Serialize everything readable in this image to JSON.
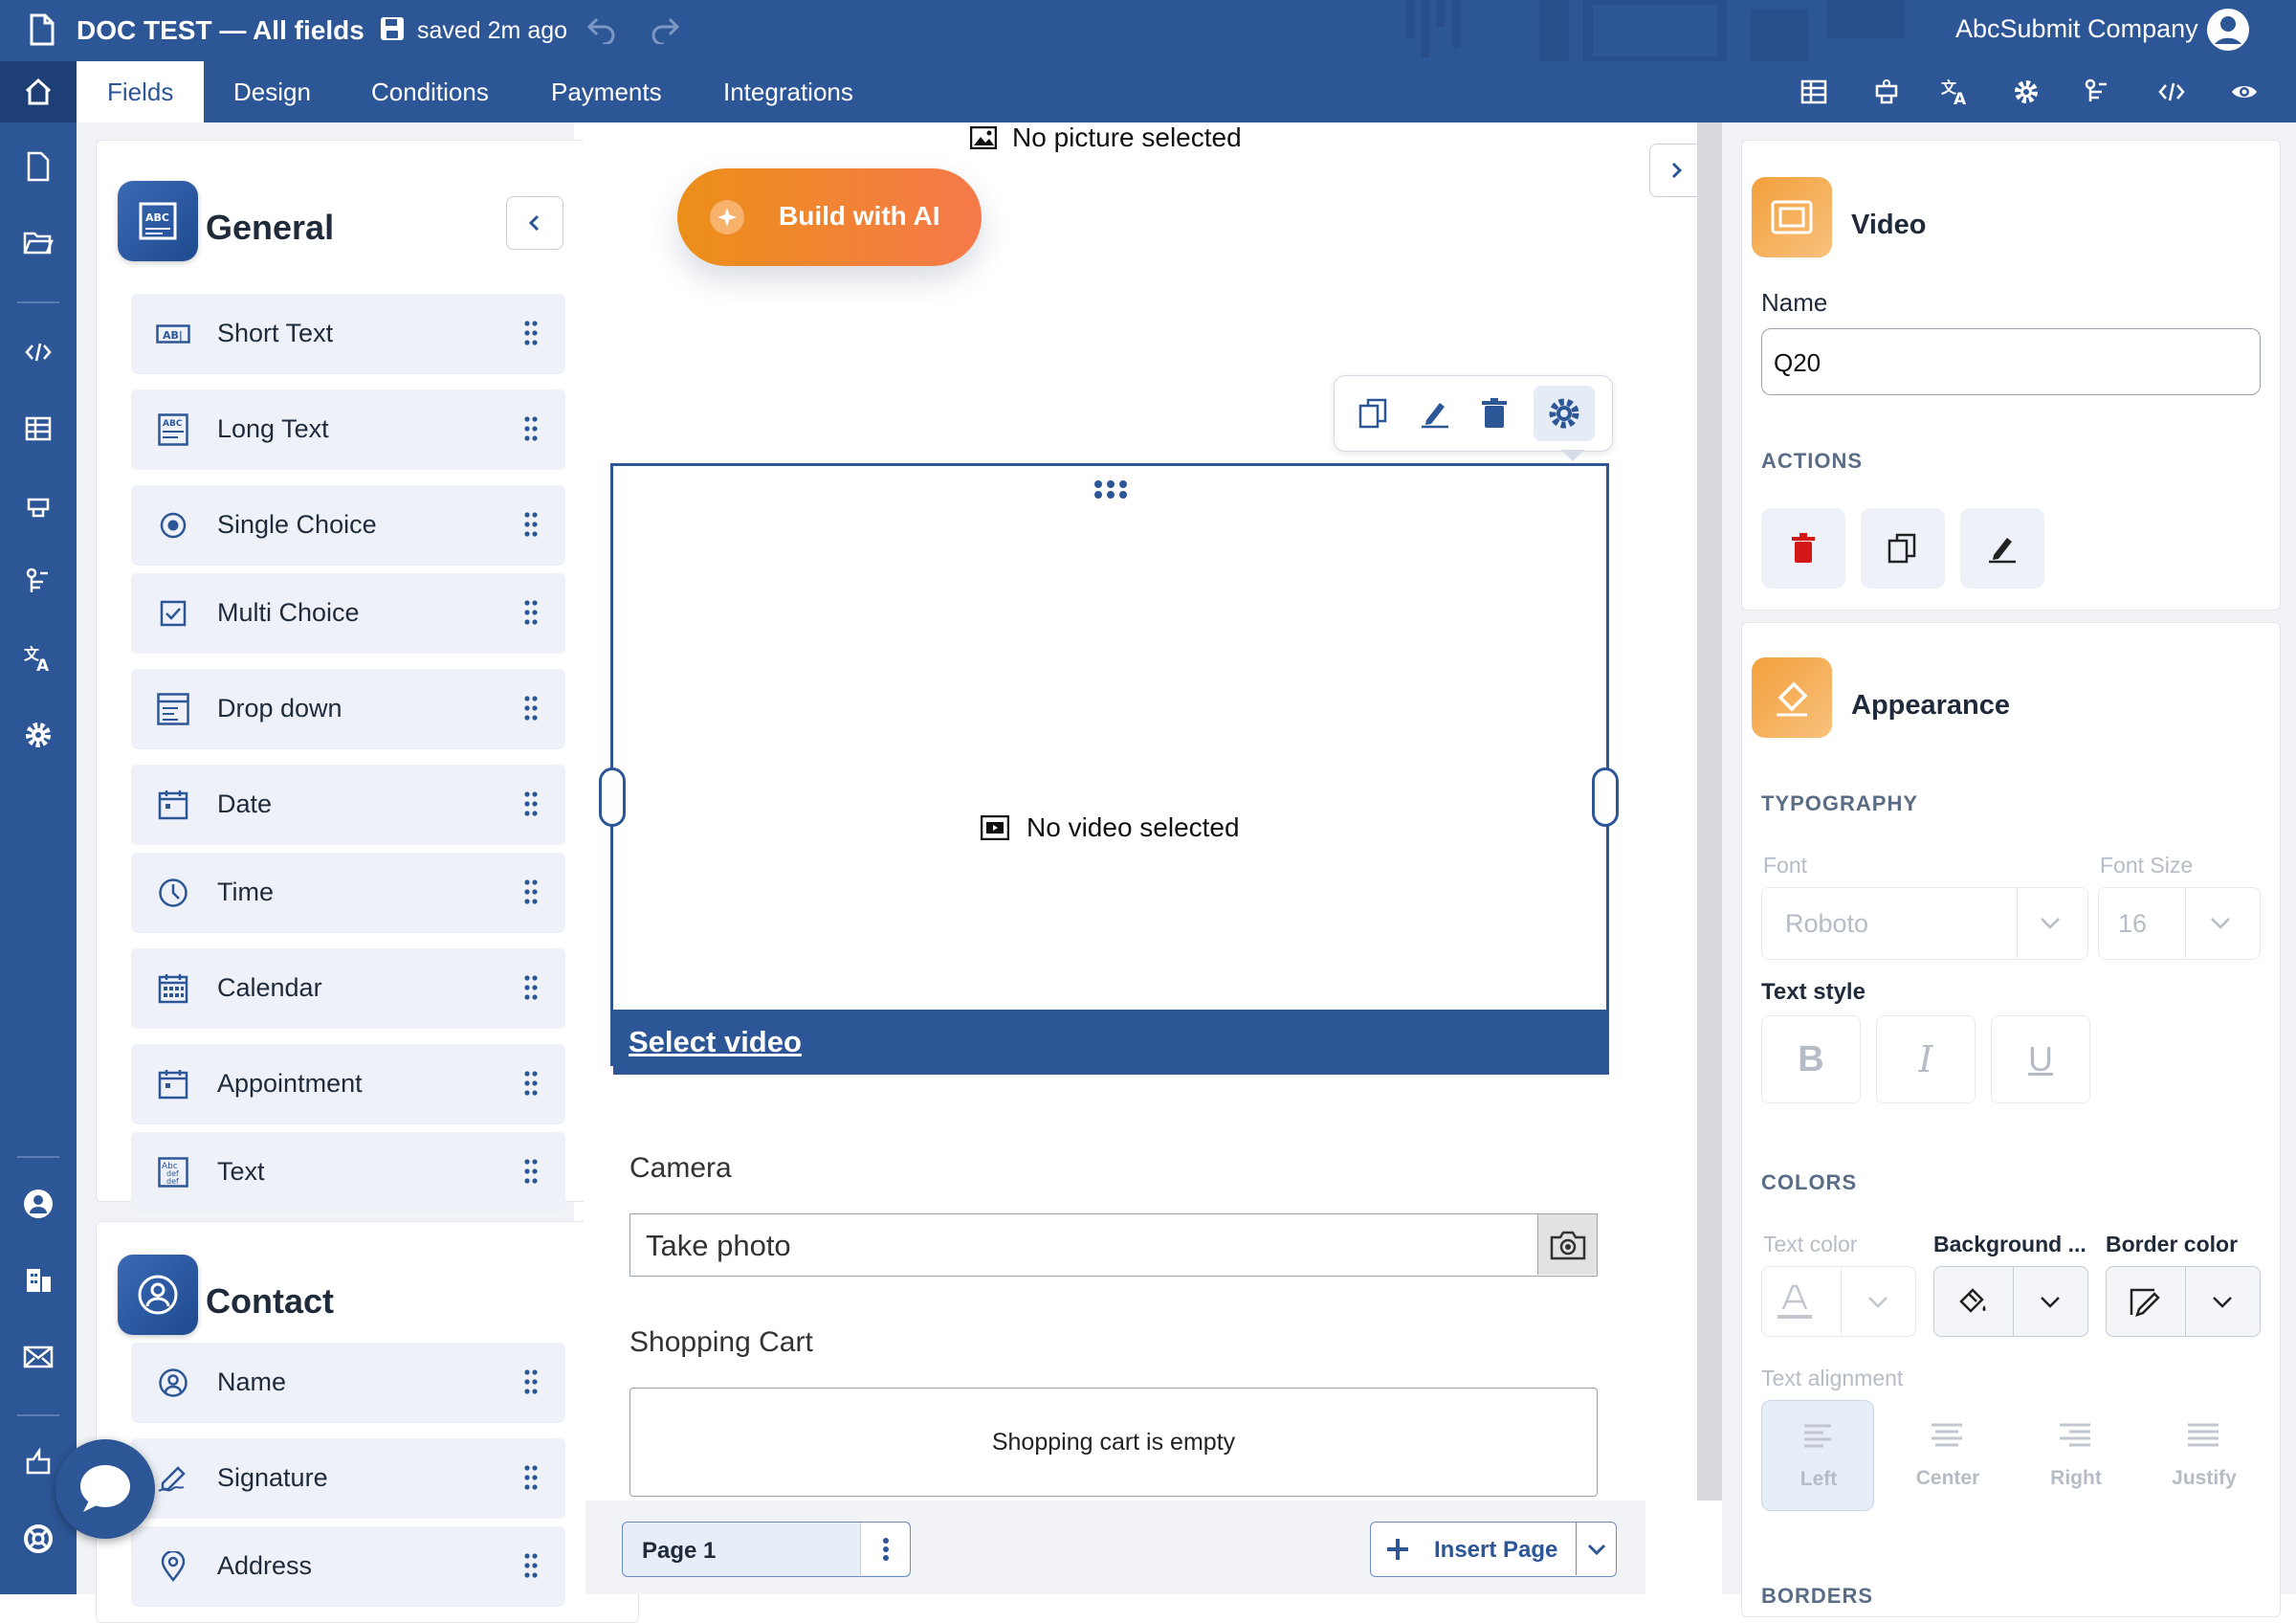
{
  "header": {
    "doc_title": "DOC TEST — All fields",
    "saved_status": "saved 2m ago",
    "company": "AbcSubmit Company",
    "tabs": [
      "Fields",
      "Design",
      "Conditions",
      "Payments",
      "Integrations"
    ],
    "active_tab": "Fields",
    "colors": {
      "brand": "#2d5697",
      "accent": "#f08a2a"
    }
  },
  "palette": {
    "general": {
      "title": "General",
      "items": [
        {
          "label": "Short Text",
          "icon": "short-text-icon"
        },
        {
          "label": "Long Text",
          "icon": "long-text-icon"
        },
        {
          "label": "Single Choice",
          "icon": "radio-icon"
        },
        {
          "label": "Multi Choice",
          "icon": "checkbox-icon"
        },
        {
          "label": "Drop down",
          "icon": "dropdown-icon"
        },
        {
          "label": "Date",
          "icon": "date-icon"
        },
        {
          "label": "Time",
          "icon": "clock-icon"
        },
        {
          "label": "Calendar",
          "icon": "calendar-icon"
        },
        {
          "label": "Appointment",
          "icon": "appointment-icon"
        },
        {
          "label": "Text",
          "icon": "text-icon"
        }
      ]
    },
    "contact": {
      "title": "Contact",
      "items": [
        {
          "label": "Name",
          "icon": "person-icon"
        },
        {
          "label": "Signature",
          "icon": "signature-icon"
        },
        {
          "label": "Address",
          "icon": "pin-icon"
        }
      ]
    }
  },
  "canvas": {
    "no_picture": "No picture selected",
    "build_ai": "Build with AI",
    "no_video": "No video selected",
    "select_video": "Select video",
    "camera_label": "Camera",
    "camera_value": "Take photo",
    "cart_label": "Shopping Cart",
    "cart_empty": "Shopping cart is empty",
    "page_label": "Page 1",
    "insert_page": "Insert Page"
  },
  "props": {
    "element_title": "Video",
    "name_label": "Name",
    "name_value": "Q20",
    "actions_heading": "ACTIONS",
    "appearance_title": "Appearance",
    "typography_heading": "TYPOGRAPHY",
    "font_label": "Font",
    "font_value": "Roboto",
    "font_size_label": "Font Size",
    "font_size_value": "16",
    "text_style_label": "Text style",
    "text_style_buttons": [
      "B",
      "I",
      "U"
    ],
    "colors_heading": "COLORS",
    "text_color_label": "Text color",
    "background_label": "Background ...",
    "border_color_label": "Border color",
    "text_alignment_label": "Text alignment",
    "alignments": [
      "Left",
      "Center",
      "Right",
      "Justify"
    ],
    "selected_alignment": "Left",
    "borders_heading": "BORDERS"
  }
}
